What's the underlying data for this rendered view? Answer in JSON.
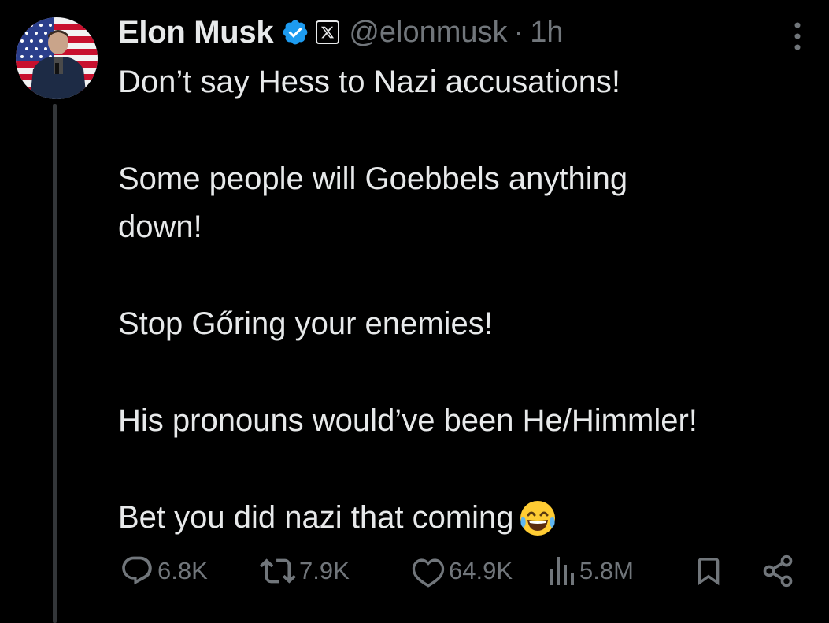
{
  "user": {
    "name": "Elon Musk",
    "handle": "@elonmusk",
    "separator": "·",
    "time": "1h"
  },
  "tweet": {
    "paragraphs": [
      "Don’t say Hess to Nazi accusations!",
      "Some people will Goebbels anything\ndown!",
      "Stop Gőring your enemies!",
      "His pronouns would’ve been He/Himmler!",
      "Bet you did nazi that coming"
    ],
    "emoji": "face-with-tears-of-joy"
  },
  "actions": {
    "replies": "6.8K",
    "reposts": "7.9K",
    "likes": "64.9K",
    "views": "5.8M"
  },
  "colors": {
    "background": "#000000",
    "text": "#e7e9ea",
    "muted": "#71767b",
    "verified": "#1d9bf0"
  }
}
